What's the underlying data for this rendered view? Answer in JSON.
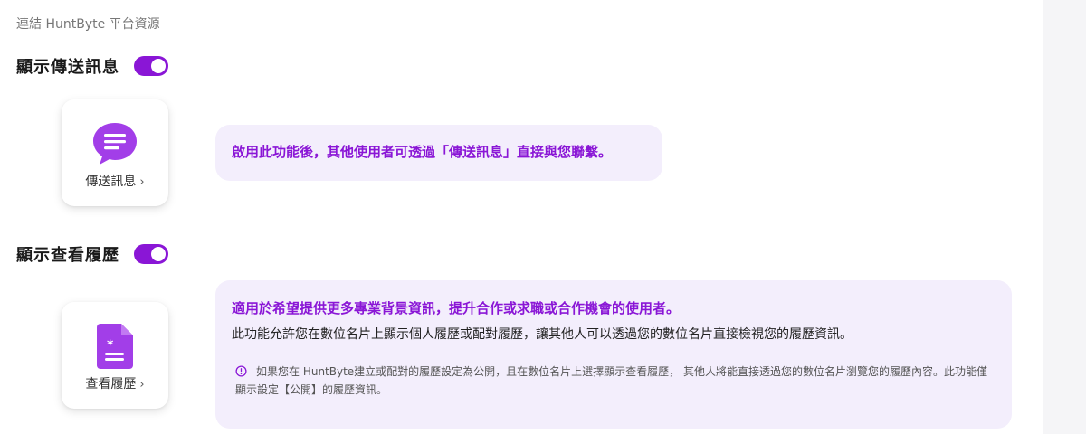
{
  "section": {
    "title": "連結 HuntByte 平台資源"
  },
  "messaging": {
    "toggle_label": "顯示傳送訊息",
    "toggle_on": true,
    "card_label": "傳送訊息",
    "card_icon": "chat-bubble-icon",
    "description": "啟用此功能後，其他使用者可透過「傳送訊息」直接與您聯繫。"
  },
  "resume": {
    "toggle_label": "顯示查看履歷",
    "toggle_on": true,
    "card_label": "查看履歷",
    "card_icon": "document-icon",
    "headline": "適用於希望提供更多專業背景資訊，提升合作或求職或合作機會的使用者。",
    "description": "此功能允許您在數位名片上顯示個人履歷或配對履歷，讓其他人可以透過您的數位名片直接檢視您的履歷資訊。",
    "note": "如果您在 HuntByte建立或配對的履歷設定為公開，且在數位名片上選擇顯示查看履歷， 其他人將能直接透過您的數位名片瀏覽您的履歷內容。此功能僅顯示設定【公開】的履歷資訊。",
    "note_icon": "info-circle-icon"
  },
  "colors": {
    "accent": "#8a16d6",
    "bubble_bg": "#f3eefc",
    "card_icon_purple": "#a23ee8"
  }
}
